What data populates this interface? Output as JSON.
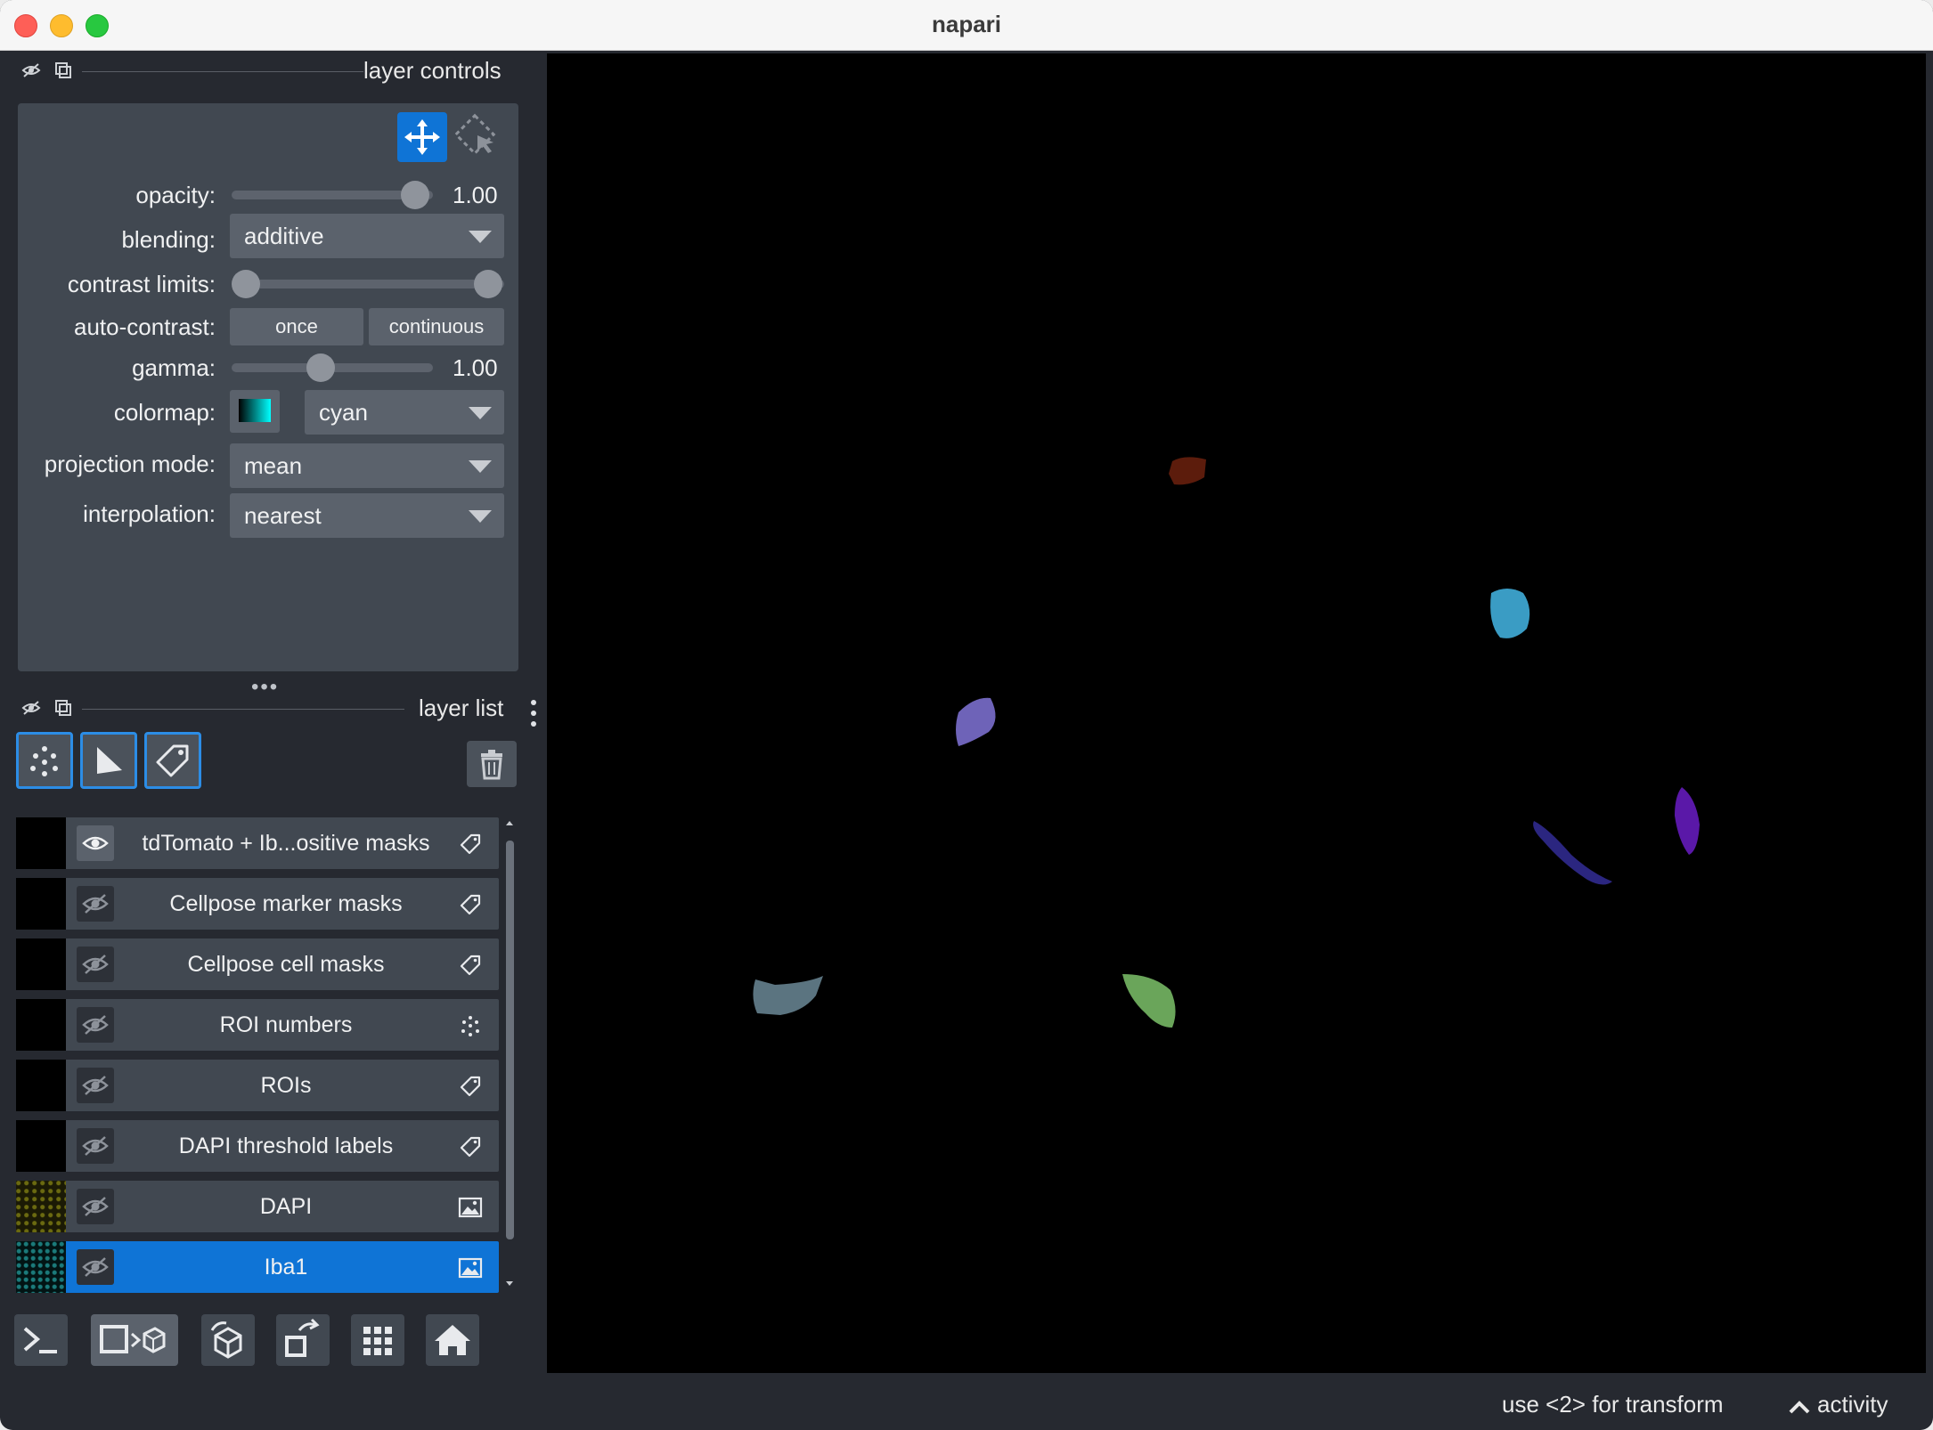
{
  "window": {
    "title": "napari"
  },
  "layer_controls": {
    "header": "layer controls",
    "opacity": {
      "label": "opacity:",
      "value": "1.00"
    },
    "blending": {
      "label": "blending:",
      "value": "additive"
    },
    "contrast_limits": {
      "label": "contrast limits:"
    },
    "auto_contrast": {
      "label": "auto-contrast:",
      "once": "once",
      "continuous": "continuous"
    },
    "gamma": {
      "label": "gamma:",
      "value": "1.00"
    },
    "colormap": {
      "label": "colormap:",
      "value": "cyan"
    },
    "projection_mode": {
      "label": "projection mode:",
      "value": "mean"
    },
    "interpolation": {
      "label": "interpolation:",
      "value": "nearest"
    }
  },
  "layer_list": {
    "header": "layer list",
    "layers": [
      {
        "name": "tdTomato + Ib...ositive masks",
        "type": "labels",
        "visible": true,
        "selected": false
      },
      {
        "name": "Cellpose marker masks",
        "type": "labels",
        "visible": false,
        "selected": false
      },
      {
        "name": "Cellpose cell masks",
        "type": "labels",
        "visible": false,
        "selected": false
      },
      {
        "name": "ROI numbers",
        "type": "points",
        "visible": false,
        "selected": false
      },
      {
        "name": "ROIs",
        "type": "labels",
        "visible": false,
        "selected": false
      },
      {
        "name": "DAPI threshold labels",
        "type": "labels",
        "visible": false,
        "selected": false
      },
      {
        "name": "DAPI",
        "type": "image",
        "visible": false,
        "selected": false
      },
      {
        "name": "Iba1",
        "type": "image",
        "visible": false,
        "selected": true
      }
    ]
  },
  "status": {
    "hint": "use <2> for transform",
    "activity": "activity"
  },
  "colors": {
    "accent": "#0f74d6",
    "panel": "#414851",
    "background": "#262930"
  }
}
